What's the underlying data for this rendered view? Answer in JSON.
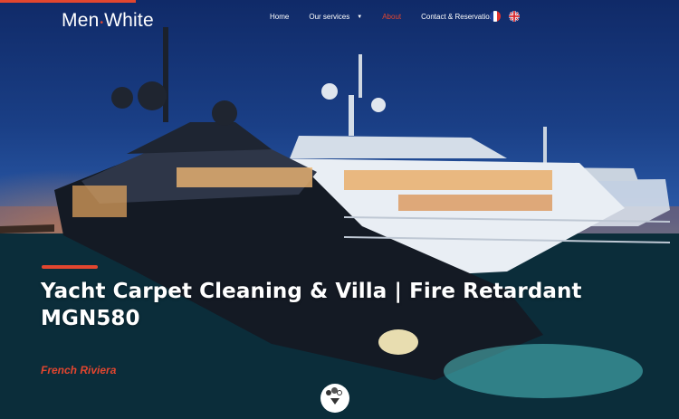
{
  "logo": {
    "text_left": "Men",
    "separator": "•",
    "text_right": "White"
  },
  "nav": {
    "items": [
      {
        "label": "Home"
      },
      {
        "label": "Our services"
      },
      {
        "label": "About"
      },
      {
        "label": "Contact & Reservation"
      }
    ],
    "active": "About"
  },
  "languages": {
    "fr": "French",
    "en": "English"
  },
  "hero": {
    "title": "Yacht Carpet Cleaning & Villa | Fire Retardant MGN580",
    "subtitle": "French Riviera"
  },
  "colors": {
    "accent": "#e2462f",
    "text": "#ffffff",
    "sky": "#1a3f86"
  },
  "icons": {
    "submenu": "chevron-down-icon",
    "scroll": "scroll-down-icon"
  }
}
